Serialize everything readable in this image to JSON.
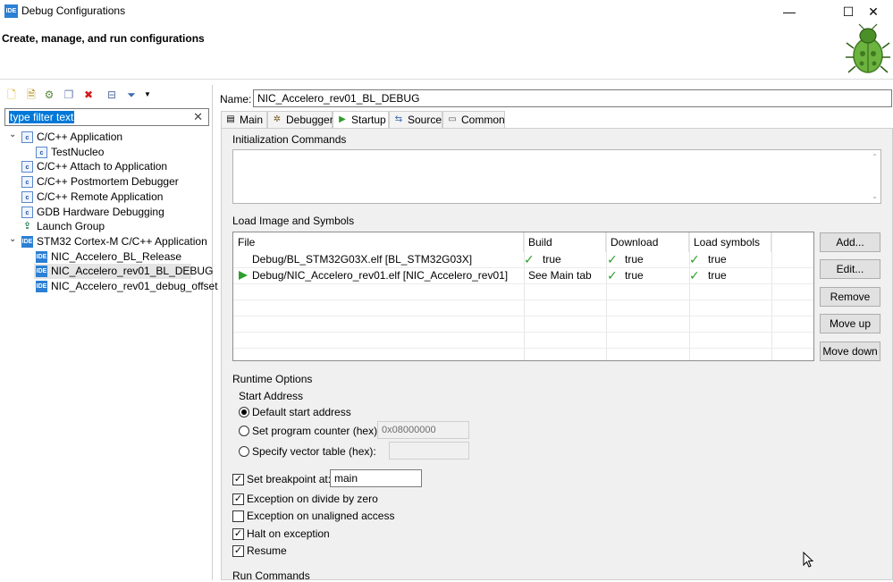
{
  "window": {
    "title": "Debug Configurations",
    "app_icon": "IDE",
    "minimize": "—",
    "maximize": "☐",
    "close": "✕"
  },
  "header": {
    "title": "Create, manage, and run configurations",
    "icon": "bug-icon"
  },
  "left": {
    "toolbar_icons": [
      "new-config-icon",
      "new-prototype-icon",
      "export-icon",
      "duplicate-icon",
      "delete-icon",
      "collapse-all-icon",
      "filter-icon",
      "dropdown-icon"
    ],
    "filter_text": "type filter text",
    "tree": [
      {
        "label": "C/C++ Application",
        "level": 0,
        "icon": "c",
        "expanded": true
      },
      {
        "label": "TestNucleo",
        "level": 1,
        "icon": "c"
      },
      {
        "label": "C/C++ Attach to Application",
        "level": 0,
        "icon": "c"
      },
      {
        "label": "C/C++ Postmortem Debugger",
        "level": 0,
        "icon": "c"
      },
      {
        "label": "C/C++ Remote Application",
        "level": 0,
        "icon": "c"
      },
      {
        "label": "GDB Hardware Debugging",
        "level": 0,
        "icon": "c"
      },
      {
        "label": "Launch Group",
        "level": 0,
        "icon": "launch"
      },
      {
        "label": "STM32 Cortex-M C/C++ Application",
        "level": 0,
        "icon": "ide",
        "expanded": true
      },
      {
        "label": "NIC_Accelero_BL_Release",
        "level": 1,
        "icon": "ide"
      },
      {
        "label": "NIC_Accelero_rev01_BL_DEBUG",
        "level": 1,
        "icon": "ide",
        "selected": true
      },
      {
        "label": "NIC_Accelero_rev01_debug_offset",
        "level": 1,
        "icon": "ide"
      }
    ]
  },
  "right": {
    "name_label": "Name:",
    "name_value": "NIC_Accelero_rev01_BL_DEBUG",
    "tabs": [
      {
        "label": "Main",
        "icon": "main-tab-icon"
      },
      {
        "label": "Debugger",
        "icon": "debugger-tab-icon"
      },
      {
        "label": "Startup",
        "icon": "startup-tab-icon",
        "active": true
      },
      {
        "label": "Source",
        "icon": "source-tab-icon"
      },
      {
        "label": "Common",
        "icon": "common-tab-icon"
      }
    ],
    "init_commands_title": "Initialization Commands",
    "load_image_title": "Load Image and Symbols",
    "table": {
      "headers": [
        "File",
        "Build",
        "Download",
        "Load symbols"
      ],
      "rows": [
        {
          "file": "Debug/BL_STM32G03X.elf [BL_STM32G03X]",
          "build": "true",
          "download": "true",
          "load_symbols": "true",
          "build_check": true
        },
        {
          "file": "Debug/NIC_Accelero_rev01.elf [NIC_Accelero_rev01]",
          "build": "See Main tab",
          "download": "true",
          "load_symbols": "true",
          "build_check": false,
          "active": true
        }
      ]
    },
    "buttons": {
      "add": "Add...",
      "edit": "Edit...",
      "remove": "Remove",
      "move_up": "Move up",
      "move_down": "Move down"
    },
    "runtime_title": "Runtime Options",
    "start_address_title": "Start Address",
    "radios": {
      "default": "Default start address",
      "set_pc": "Set program counter (hex):",
      "set_pc_value": "0x08000000",
      "vector": "Specify vector table (hex):",
      "vector_value": ""
    },
    "checks": {
      "breakpoint": "Set breakpoint at:",
      "breakpoint_value": "main",
      "divide_zero": "Exception on divide by zero",
      "unaligned": "Exception on unaligned access",
      "halt": "Halt on exception",
      "resume": "Resume"
    },
    "check_marks": "✓",
    "run_commands_title": "Run Commands"
  }
}
